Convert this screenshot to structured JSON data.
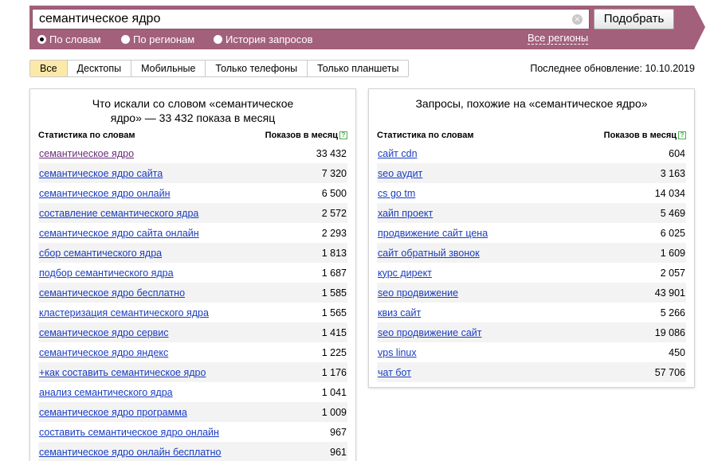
{
  "search": {
    "query": "семантическое ядро",
    "submit_label": "Подобрать",
    "clear_glyph": "×"
  },
  "modes": [
    {
      "label": "По словам",
      "checked": true
    },
    {
      "label": "По регионам",
      "checked": false
    },
    {
      "label": "История запросов",
      "checked": false
    }
  ],
  "regions_link": "Все регионы",
  "tabs": [
    "Все",
    "Десктопы",
    "Мобильные",
    "Только телефоны",
    "Только планшеты"
  ],
  "active_tab": "Все",
  "last_update": "Последнее обновление: 10.10.2019",
  "colors": {
    "header": "#a3607a",
    "active_tab": "#fce9a8",
    "link": "#1a3dc1",
    "visited_link": "#6b2d7a",
    "row_alt": "#f3f3f3"
  },
  "left_panel": {
    "title_line1": "Что искали со словом «семантическое",
    "title_line2": "ядро» — 33 432 показа в месяц",
    "col_phrase": "Статистика по словам",
    "col_count": "Показов в месяц",
    "help_glyph": "?",
    "rows": [
      {
        "phrase": "семантическое ядро",
        "count": "33 432"
      },
      {
        "phrase": "семантическое ядро сайта",
        "count": "7 320"
      },
      {
        "phrase": "семантическое ядро онлайн",
        "count": "6 500"
      },
      {
        "phrase": "составление семантического ядра",
        "count": "2 572"
      },
      {
        "phrase": "семантическое ядро сайта онлайн",
        "count": "2 293"
      },
      {
        "phrase": "сбор семантического ядра",
        "count": "1 813"
      },
      {
        "phrase": "подбор семантического ядра",
        "count": "1 687"
      },
      {
        "phrase": "семантическое ядро бесплатно",
        "count": "1 585"
      },
      {
        "phrase": "кластеризация семантического ядра",
        "count": "1 565"
      },
      {
        "phrase": "семантическое ядро сервис",
        "count": "1 415"
      },
      {
        "phrase": "семантическое ядро яндекс",
        "count": "1 225"
      },
      {
        "phrase": "+как составить семантическое ядро",
        "count": "1 176"
      },
      {
        "phrase": "анализ семантического ядра",
        "count": "1 041"
      },
      {
        "phrase": "семантическое ядро программа",
        "count": "1 009"
      },
      {
        "phrase": "составить семантическое ядро онлайн",
        "count": "967"
      },
      {
        "phrase": "семантическое ядро онлайн бесплатно",
        "count": "961"
      }
    ]
  },
  "right_panel": {
    "title": "Запросы, похожие на «семантическое ядро»",
    "col_phrase": "Статистика по словам",
    "col_count": "Показов в месяц",
    "help_glyph": "?",
    "rows": [
      {
        "phrase": "сайт cdn",
        "count": "604"
      },
      {
        "phrase": "seo аудит",
        "count": "3 163"
      },
      {
        "phrase": "cs go tm",
        "count": "14 034"
      },
      {
        "phrase": "хайп проект",
        "count": "5 469"
      },
      {
        "phrase": "продвижение сайт цена",
        "count": "6 025"
      },
      {
        "phrase": "сайт обратный звонок",
        "count": "1 609"
      },
      {
        "phrase": "курс директ",
        "count": "2 057"
      },
      {
        "phrase": "seo продвижение",
        "count": "43 901"
      },
      {
        "phrase": "квиз сайт",
        "count": "5 266"
      },
      {
        "phrase": "seo продвижение сайт",
        "count": "19 086"
      },
      {
        "phrase": "vps linux",
        "count": "450"
      },
      {
        "phrase": "чат бот",
        "count": "57 706"
      }
    ]
  }
}
